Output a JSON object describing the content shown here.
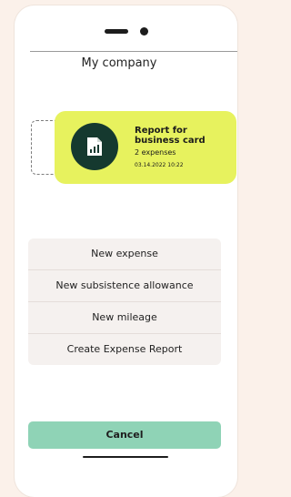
{
  "header": {
    "company_name": "My company"
  },
  "report_card": {
    "icon": "document-chart-icon",
    "title": "Report for business card",
    "expense_count": "2 expenses",
    "datetime": "03.14.2022  10:22",
    "accent_color": "#e7f25e"
  },
  "actions": [
    {
      "label": "New expense"
    },
    {
      "label": "New subsistence allowance"
    },
    {
      "label": "New mileage"
    },
    {
      "label": "Create Expense Report"
    }
  ],
  "cancel_label": "Cancel",
  "colors": {
    "cancel_button": "#8fd3b6",
    "icon_circle": "#15392f"
  }
}
